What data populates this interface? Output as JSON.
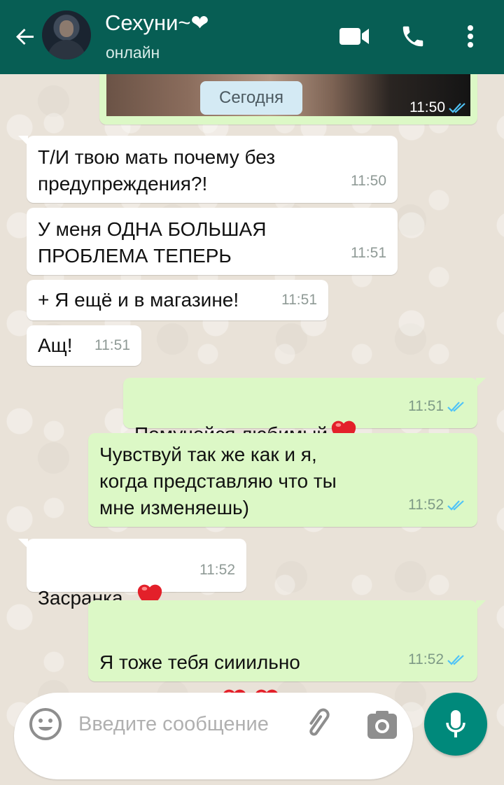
{
  "header": {
    "contact_name": "Сехуни~❤",
    "status": "онлайн",
    "color": "#075e54"
  },
  "date_divider": "Сегодня",
  "media_message": {
    "time": "11:50",
    "read": true
  },
  "messages": [
    {
      "dir": "in",
      "text": "Т/И твою мать почему без\nпредупреждения?!",
      "time": "11:50"
    },
    {
      "dir": "in",
      "text": "У меня ОДНА БОЛЬШАЯ\nПРОБЛЕМА ТЕПЕРЬ",
      "time": "11:51"
    },
    {
      "dir": "in",
      "text": "+ Я ещё и в магазине!",
      "time": "11:51"
    },
    {
      "dir": "in",
      "text": "Ащ!",
      "time": "11:51"
    },
    {
      "dir": "out",
      "text": "Помучейся любимый",
      "emoji": "heart",
      "time": "11:51",
      "read": true
    },
    {
      "dir": "out",
      "text": "Чувствуй так же как и я,\nкогда представляю что ты\nмне изменяешь)",
      "time": "11:52",
      "read": true
    },
    {
      "dir": "in",
      "text": "Засранка..",
      "emoji": "heart",
      "time": "11:52"
    },
    {
      "dir": "out",
      "text": "Я тоже тебя сииильно\nлюблю зайка",
      "emoji": "heart-heart",
      "time": "11:52",
      "read": true
    }
  ],
  "composer": {
    "placeholder": "Введите сообщение"
  },
  "icons": {
    "back": "arrow-left-icon",
    "video": "video-camera-icon",
    "call": "phone-icon",
    "menu": "more-vertical-icon",
    "emoji": "smiley-icon",
    "attach": "paperclip-icon",
    "camera": "camera-icon",
    "mic": "microphone-icon",
    "read": "double-check-icon"
  },
  "colors": {
    "incoming_bubble": "#ffffff",
    "outgoing_bubble": "#dcf8c6",
    "read_receipt": "#4fc3f7",
    "mic_button": "#00897b"
  }
}
